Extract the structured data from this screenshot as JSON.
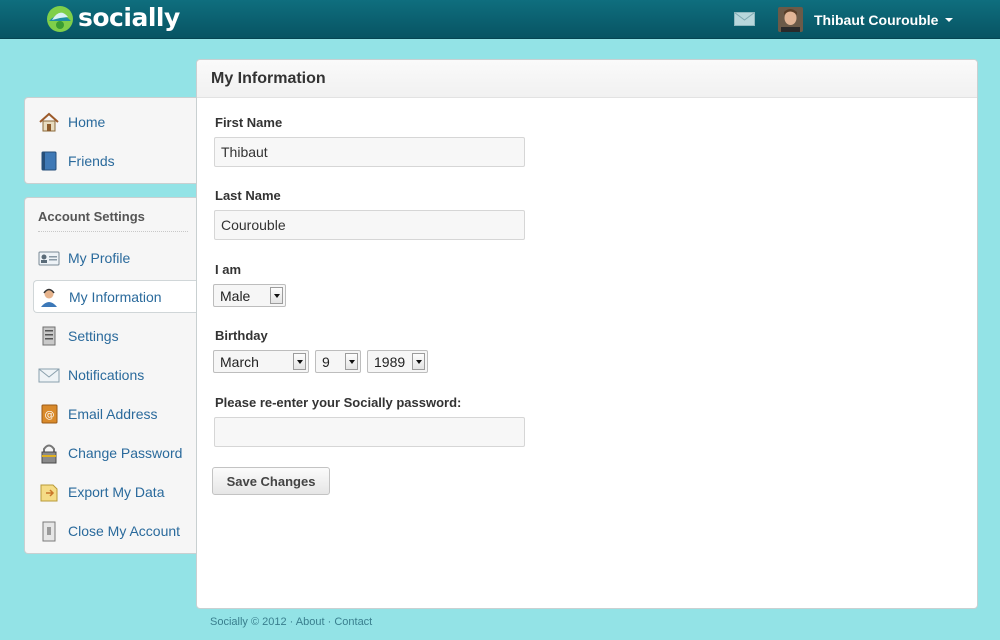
{
  "app": {
    "name": "socially"
  },
  "header": {
    "user_name": "Thibaut Courouble",
    "icons": {
      "logo": "socially-leaf-logo",
      "mail": "envelope-icon",
      "caret": "caret-down-icon"
    }
  },
  "sidebar": {
    "nav": [
      {
        "label": "Home",
        "icon": "home-icon"
      },
      {
        "label": "Friends",
        "icon": "book-icon"
      }
    ],
    "settings_title": "Account Settings",
    "settings": [
      {
        "label": "My Profile",
        "icon": "id-card-icon"
      },
      {
        "label": "My Information",
        "icon": "user-headset-icon",
        "active": true
      },
      {
        "label": "Settings",
        "icon": "server-icon"
      },
      {
        "label": "Notifications",
        "icon": "envelope-icon"
      },
      {
        "label": "Email Address",
        "icon": "address-book-icon"
      },
      {
        "label": "Change Password",
        "icon": "lock-icon"
      },
      {
        "label": "Export My Data",
        "icon": "export-icon"
      },
      {
        "label": "Close My Account",
        "icon": "door-icon"
      }
    ]
  },
  "form": {
    "title": "My Information",
    "first_name_label": "First Name",
    "first_name_value": "Thibaut",
    "last_name_label": "Last Name",
    "last_name_value": "Courouble",
    "gender_label": "I am",
    "gender_value": "Male",
    "birthday_label": "Birthday",
    "birth_month": "March",
    "birth_day": "9",
    "birth_year": "1989",
    "password_label": "Please re-enter your Socially password:",
    "password_value": "",
    "save_label": "Save Changes"
  },
  "footer": {
    "copyright": "Socially © 2012",
    "sep": "·",
    "about": "About",
    "contact": "Contact"
  },
  "colors": {
    "page_bg": "#93e3e6",
    "topbar": "#0b6272",
    "link": "#2a6a9c"
  }
}
